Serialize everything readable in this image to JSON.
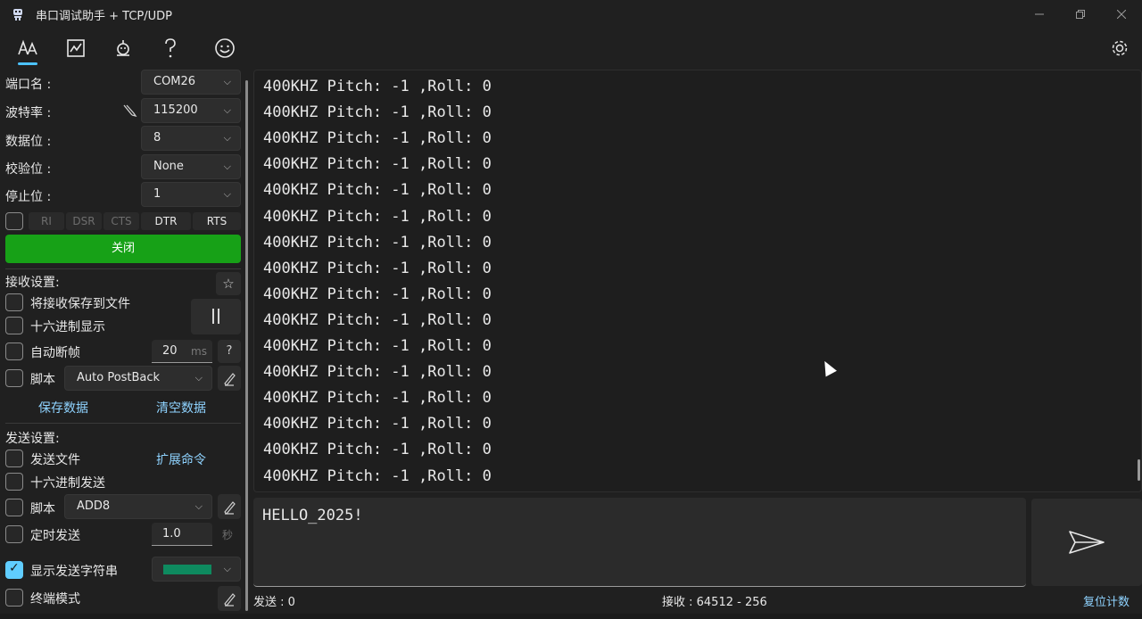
{
  "window": {
    "title": "串口调试助手 + TCP/UDP"
  },
  "serial": {
    "port_label": "端口名 :",
    "port_value": "COM26",
    "baud_label": "波特率 :",
    "baud_value": "115200",
    "databits_label": "数据位 :",
    "databits_value": "8",
    "parity_label": "校验位 :",
    "parity_value": "None",
    "stopbits_label": "停止位 :",
    "stopbits_value": "1",
    "signals": [
      "RI",
      "DSR",
      "CTS",
      "DTR",
      "RTS"
    ],
    "close_button": "关闭"
  },
  "receive": {
    "section_label": "接收设置:",
    "save_to_file": "将接收保存到文件",
    "hex_display": "十六进制显示",
    "auto_frame": "自动断帧",
    "frame_ms": "20",
    "frame_unit": "ms",
    "script_label": "脚本",
    "script_value": "Auto PostBack",
    "save_data": "保存数据",
    "clear_data": "清空数据",
    "lines": [
      "400KHZ Pitch: -1 ,Roll: 0",
      "400KHZ Pitch: -1 ,Roll: 0",
      "400KHZ Pitch: -1 ,Roll: 0",
      "400KHZ Pitch: -1 ,Roll: 0",
      "400KHZ Pitch: -1 ,Roll: 0",
      "400KHZ Pitch: -1 ,Roll: 0",
      "400KHZ Pitch: -1 ,Roll: 0",
      "400KHZ Pitch: -1 ,Roll: 0",
      "400KHZ Pitch: -1 ,Roll: 0",
      "400KHZ Pitch: -1 ,Roll: 0",
      "400KHZ Pitch: -1 ,Roll: 0",
      "400KHZ Pitch: -1 ,Roll: 0",
      "400KHZ Pitch: -1 ,Roll: 0",
      "400KHZ Pitch: -1 ,Roll: 0",
      "400KHZ Pitch: -1 ,Roll: 0",
      "400KHZ Pitch: -1 ,Roll: 0"
    ]
  },
  "send": {
    "section_label": "发送设置:",
    "send_file": "发送文件",
    "extend_cmd": "扩展命令",
    "hex_send": "十六进制发送",
    "script_label": "脚本",
    "script_value": "ADD8",
    "timed_send": "定时发送",
    "interval": "1.0",
    "interval_unit": "秒",
    "show_send": "显示发送字符串",
    "terminal_mode": "终端模式",
    "input_text": "HELLO_2025!",
    "show_send_color": "#0e8a5f"
  },
  "status": {
    "sent": "发送 : 0",
    "received": "接收 : 64512 - 256",
    "reset": "复位计数"
  },
  "colors": {
    "accent": "#60cdff",
    "close_green": "#17a117",
    "link": "#8fd3ff"
  }
}
